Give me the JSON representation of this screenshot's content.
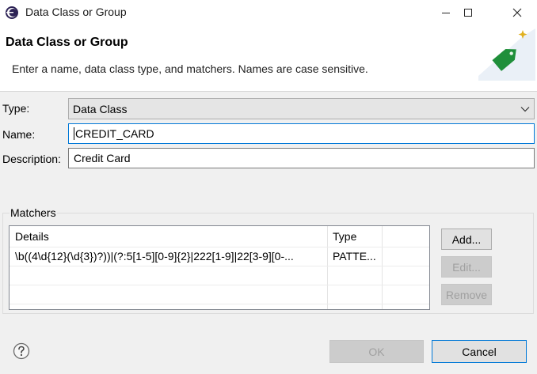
{
  "window": {
    "title": "Data Class or Group",
    "app_icon": "eclipse-icon",
    "controls": [
      "minimize-icon",
      "maximize-icon",
      "close-icon"
    ]
  },
  "header": {
    "title": "Data Class or Group",
    "description": "Enter a name, data class type, and matchers. Names are case sensitive.",
    "image": "tag-icon"
  },
  "form": {
    "type_label": "Type:",
    "type_value": "Data Class",
    "name_label": "Name:",
    "name_value": "CREDIT_CARD",
    "description_label": "Description:",
    "description_value": "Credit Card"
  },
  "matchers": {
    "group_label": "Matchers",
    "columns": [
      "Details",
      "Type"
    ],
    "rows": [
      {
        "details": "\\b((4\\d{12}(\\d{3})?))|(?:5[1-5][0-9]{2}|222[1-9]|22[3-9][0-...",
        "type": "PATTE..."
      }
    ],
    "buttons": {
      "add": "Add...",
      "edit": "Edit...",
      "remove": "Remove"
    }
  },
  "footer": {
    "help_icon": "help-icon",
    "ok_label": "OK",
    "cancel_label": "Cancel"
  },
  "colors": {
    "accent": "#0078d7",
    "tag_green": "#1f8f3a"
  }
}
